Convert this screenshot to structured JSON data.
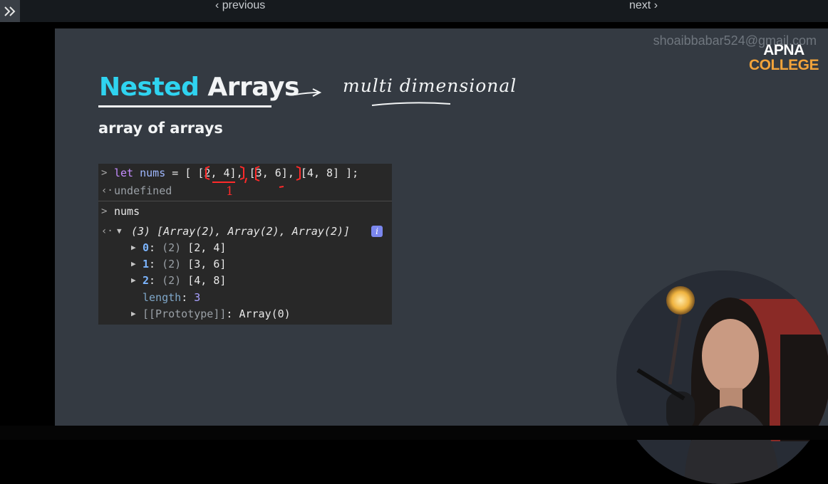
{
  "nav": {
    "previous": "‹ previous",
    "next": "next ›"
  },
  "slide": {
    "watermark": "shoaibbabar524@gmail.com",
    "logo_top": "APNA",
    "logo_bottom": "COLLEGE",
    "title_part1": "Nested",
    "title_part2": "Arrays",
    "subtitle": "array of arrays",
    "handwriting": "multi dimensional",
    "handwriting_mark": "1"
  },
  "console": {
    "line1": {
      "prompt": ">",
      "kw": "let",
      "name": "nums",
      "rest_a": " = [ ",
      "arr1": "[2, 4]",
      "comma1": ", ",
      "arr2": "[3, 6]",
      "comma2": ", ",
      "arr3": "[4, 8]",
      "rest_b": " ];"
    },
    "result1": {
      "arrow": "‹·",
      "value": "undefined"
    },
    "line2": {
      "prompt": ">",
      "value": "nums"
    },
    "result2": {
      "arrow": "‹·",
      "summary": "(3) [Array(2), Array(2), Array(2)]",
      "info": "i"
    },
    "items": [
      {
        "key": "0",
        "count": "(2)",
        "value": "[2, 4]"
      },
      {
        "key": "1",
        "count": "(2)",
        "value": "[3, 6]"
      },
      {
        "key": "2",
        "count": "(2)",
        "value": "[4, 8]"
      }
    ],
    "length": {
      "key": "length",
      "value": "3"
    },
    "prototype": {
      "key": "[[Prototype]]",
      "value": "Array(0)"
    }
  },
  "icons": {
    "expand": "double-chevron-right-icon",
    "info": "info-icon"
  }
}
